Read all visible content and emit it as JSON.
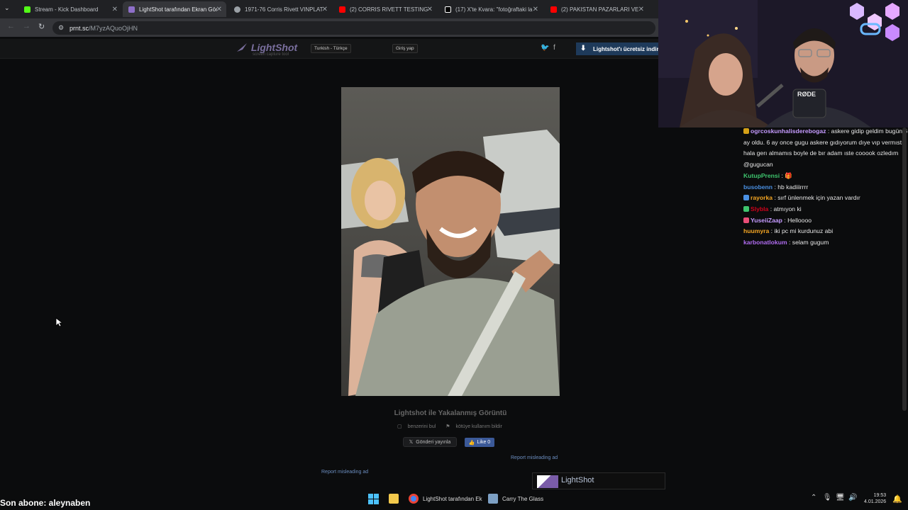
{
  "browser": {
    "tabs": [
      {
        "label": "Stream - Kick Dashboard",
        "icon": "kick-icon",
        "color": "#53fc18",
        "active": false
      },
      {
        "label": "LightShot tarafından Ekran Gör",
        "icon": "lightshot-icon",
        "color": "#8e6fc9",
        "active": true
      },
      {
        "label": "1971-76 Corris Rivett VINPLATI",
        "icon": "globe-icon",
        "color": "#9aa0a6",
        "active": false
      },
      {
        "label": "(2) CORRIS RIVETT TESTING - I",
        "icon": "youtube-icon",
        "color": "#ff0000",
        "active": false
      },
      {
        "label": "(17) X'te Kvara: \"fotoğraftaki la",
        "icon": "x-icon",
        "color": "#ffffff",
        "active": false
      },
      {
        "label": "(2) PAKISTAN PAZARLARI VE S",
        "icon": "youtube-icon",
        "color": "#ff0000",
        "active": false
      }
    ],
    "url_host": "prnt.sc",
    "url_path": "/M7yzAQuoOjHN"
  },
  "lightshot": {
    "logo": "LightShot",
    "logo_sub": "screen capture tool",
    "language": "Turkish - Türkçe",
    "login": "Giriş yap",
    "social": "🐦  f",
    "download": "Lightshot'ı ücretsiz indirin",
    "caption": "Lightshot ile Yakalanmış Görüntü",
    "find_similar": "benzerini bul",
    "report_abuse": "kötüye kullanım bildir",
    "tweet": "Gönderi yayınla",
    "like": "Like 0",
    "report_ad_1": "Report misleading ad",
    "report_ad_2": "Report misleading ad",
    "ad_title": "LightShot"
  },
  "stream": {
    "webcam_label": "RØDE",
    "chat": [
      {
        "user": "ogrcoskunhalisderebogaz",
        "color": "#c59bff",
        "badge": "#d4a017",
        "text": "askere gidip geldim bugün 6 ay oldu. 6 ay once gugu askere gıdıyorum dıye vıp vermıstı hala gerı almamıs boyle de bır adam ıste cooook ozledım @gugucan"
      },
      {
        "user": "KutupPrensi",
        "color": "#3ec46d",
        "badge": "",
        "text": "🎁"
      },
      {
        "user": "busobenn",
        "color": "#4a90e2",
        "badge": "",
        "text": "hb kadiiirrrr"
      },
      {
        "user": "rayorka",
        "color": "#f5a623",
        "badge": "#4a90e2",
        "text": "sırf ünlenmek için yazan vardır"
      },
      {
        "user": "Slybla",
        "color": "#d0021b",
        "badge": "#3ec46d",
        "text": "atmıyon ki"
      },
      {
        "user": "YuseiiZaap",
        "color": "#c59bff",
        "badge": "#e94e77",
        "text": "Helloooo"
      },
      {
        "user": "huumyra",
        "color": "#f5a623",
        "badge": "",
        "text": "iki pc mi kurdunuz abi"
      },
      {
        "user": "karbonatlokum",
        "color": "#b06cf0",
        "badge": "",
        "text": "selam gugum"
      }
    ],
    "sub_banner": "Son abone: aleynaben"
  },
  "taskbar": {
    "items": [
      {
        "label": "LightShot tarafından Ek",
        "icon": "chrome-icon",
        "color": "#4285f4"
      },
      {
        "label": "Carry The Glass",
        "icon": "game-icon",
        "color": "#7da0c4"
      }
    ],
    "time": "19:53",
    "date": "4.01.2026"
  }
}
